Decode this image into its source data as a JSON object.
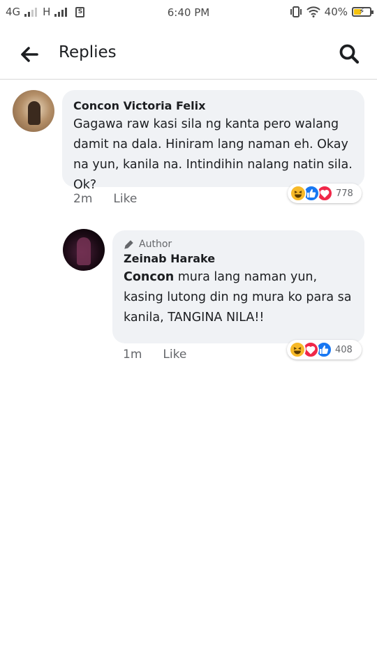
{
  "status_bar": {
    "network_left": "4G",
    "network_right": "H",
    "time": "6:40 PM",
    "battery_text": "40%",
    "battery_level": 0.4,
    "icons": [
      "signal-icon",
      "sim-icon",
      "vibrate-icon",
      "wifi-icon",
      "battery-icon"
    ]
  },
  "header": {
    "title": "Replies",
    "back_icon": "arrow-left-icon",
    "search_icon": "search-icon"
  },
  "comments": [
    {
      "author": "Concon Victoria Felix",
      "text": "Gagawa raw kasi sila ng kanta pero walang damit na dala. Hiniram lang naman eh. Okay na yun, kanila na. Intindihin nalang natin sila. Ok?",
      "time": "2m",
      "like_label": "Like",
      "reactions": [
        "haha",
        "like",
        "love"
      ],
      "reaction_count": "778"
    },
    {
      "badge": "Author",
      "author": "Zeinab Harake",
      "mention": "Concon",
      "text": " mura lang naman yun, kasing lutong din ng mura ko para sa kanila, TANGINA NILA!!",
      "time": "1m",
      "like_label": "Like",
      "reactions": [
        "haha",
        "love",
        "like"
      ],
      "reaction_count": "408"
    }
  ],
  "colors": {
    "bubble": "#f0f2f5",
    "like": "#1877f2",
    "love": "#f02849",
    "haha": "#f7b928",
    "meta_text": "#65676b"
  }
}
